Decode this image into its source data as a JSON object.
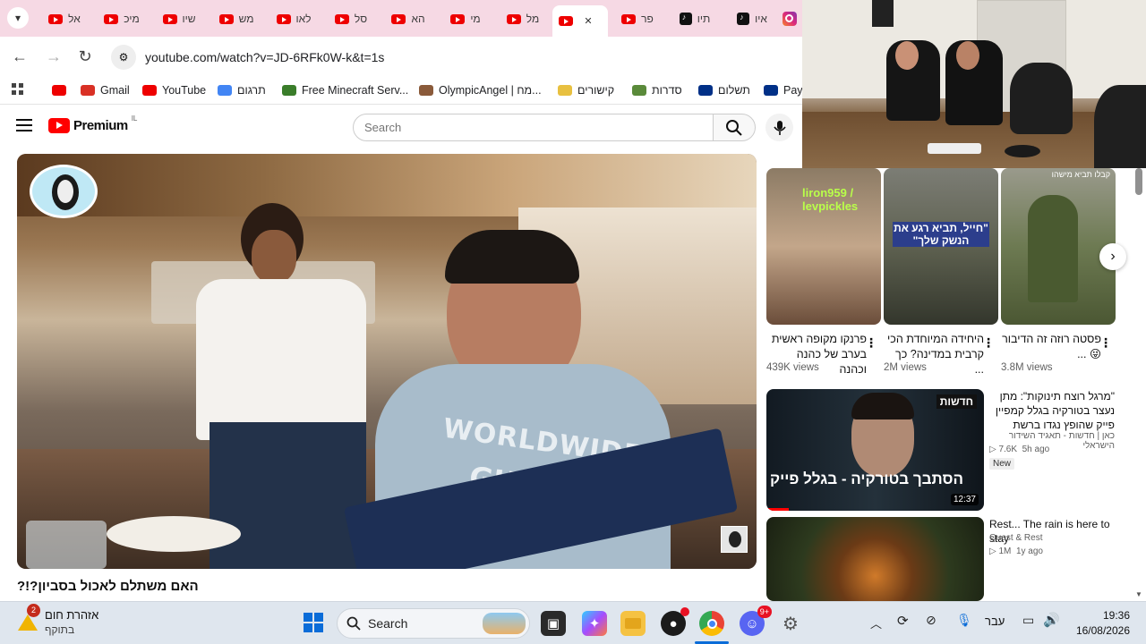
{
  "browser": {
    "tabs": [
      {
        "label": "אל",
        "type": "youtube"
      },
      {
        "label": "מיכ",
        "type": "youtube"
      },
      {
        "label": "שיו",
        "type": "youtube"
      },
      {
        "label": "מש",
        "type": "youtube"
      },
      {
        "label": "לאו",
        "type": "youtube"
      },
      {
        "label": "סל",
        "type": "youtube"
      },
      {
        "label": "הא",
        "type": "youtube"
      },
      {
        "label": "מי",
        "type": "youtube"
      },
      {
        "label": "מל",
        "type": "youtube"
      },
      {
        "label": "",
        "type": "youtube-active"
      },
      {
        "label": "פר",
        "type": "youtube"
      },
      {
        "label": "תיו",
        "type": "tiktok"
      },
      {
        "label": "איו",
        "type": "tiktok"
      },
      {
        "label": "",
        "type": "instagram"
      }
    ],
    "close_tab_glyph": "✕",
    "url": "youtube.com/watch?v=JD-6RFk0W-k&t=1s",
    "bookmarks": [
      {
        "label": "",
        "icon": "youtube-icon",
        "color": "#e00"
      },
      {
        "label": "Gmail",
        "icon": "gmail-icon",
        "color": "#d93025"
      },
      {
        "label": "YouTube",
        "icon": "youtube-icon",
        "color": "#e00"
      },
      {
        "label": "תרגום",
        "icon": "translate-icon",
        "color": "#4285f4"
      },
      {
        "label": "Free Minecraft Serv...",
        "icon": "minecraft-icon",
        "color": "#3a7d2a"
      },
      {
        "label": "OlympicAngel | מח...",
        "icon": "angel-icon",
        "color": "#8a5a3a"
      },
      {
        "label": "קישורים",
        "icon": "star-icon",
        "color": "#e8c040"
      },
      {
        "label": "סדרות",
        "icon": "tv-icon",
        "color": "#5a8a3a"
      },
      {
        "label": "תשלום",
        "icon": "paypal-icon",
        "color": "#003087"
      },
      {
        "label": "Payl",
        "icon": "paypal-icon",
        "color": "#003087"
      }
    ]
  },
  "youtube": {
    "logo_text": "Premium",
    "country_code": "IL",
    "search_placeholder": "Search",
    "video_title": "האם משתלם לאכול בסביון?!?",
    "shorts": [
      {
        "title": "פרנקו מקופה ראשית בערב של כהנה וכהנה",
        "views": "439K views",
        "overlay": "liron959 / levpickles"
      },
      {
        "title": "היחידה המיוחדת הכי קרבית במדינה? כך ...",
        "views": "2M views",
        "overlay": "\"חייל, תביא רגע את הנשק שלך\""
      },
      {
        "title": "פסטה רוזה זה הדיבור 😜 ...",
        "views": "3.8M views",
        "overlay": "קבלו תביא מישהו"
      }
    ],
    "recommended": [
      {
        "title": "\"מרגל רוצח תינוקות\": מתן נעצר בטורקיה בגלל קמפיין פייק שהופץ נגדו ברשת",
        "channel": "כאן | חדשות - תאגיד השידור הישראלי",
        "verified": true,
        "views": "7.6K",
        "age": "5h ago",
        "badge": "New",
        "duration": "12:37",
        "thumb_caption": "הסתבך בטורקיה - בגלל פייק",
        "thumb_tag": "חדשות"
      },
      {
        "title": "Rest... The rain is here to stay",
        "channel": "Quest & Rest",
        "verified": false,
        "views": "1M",
        "age": "1y ago",
        "badge": "",
        "duration": "",
        "thumb_caption": "",
        "thumb_tag": ""
      }
    ]
  },
  "taskbar": {
    "weather_title": "אזהרת חום",
    "weather_sub": "בתוקף",
    "weather_badge": "2",
    "search_label": "Search",
    "discord_badge": "9+",
    "language": "עבר",
    "time": "19:36",
    "date": "16/08/2026"
  },
  "colors": {
    "tabstrip_bg": "#f6d9e4",
    "youtube_red": "#ff0000",
    "taskbar_bg": "#dfe6ee"
  }
}
